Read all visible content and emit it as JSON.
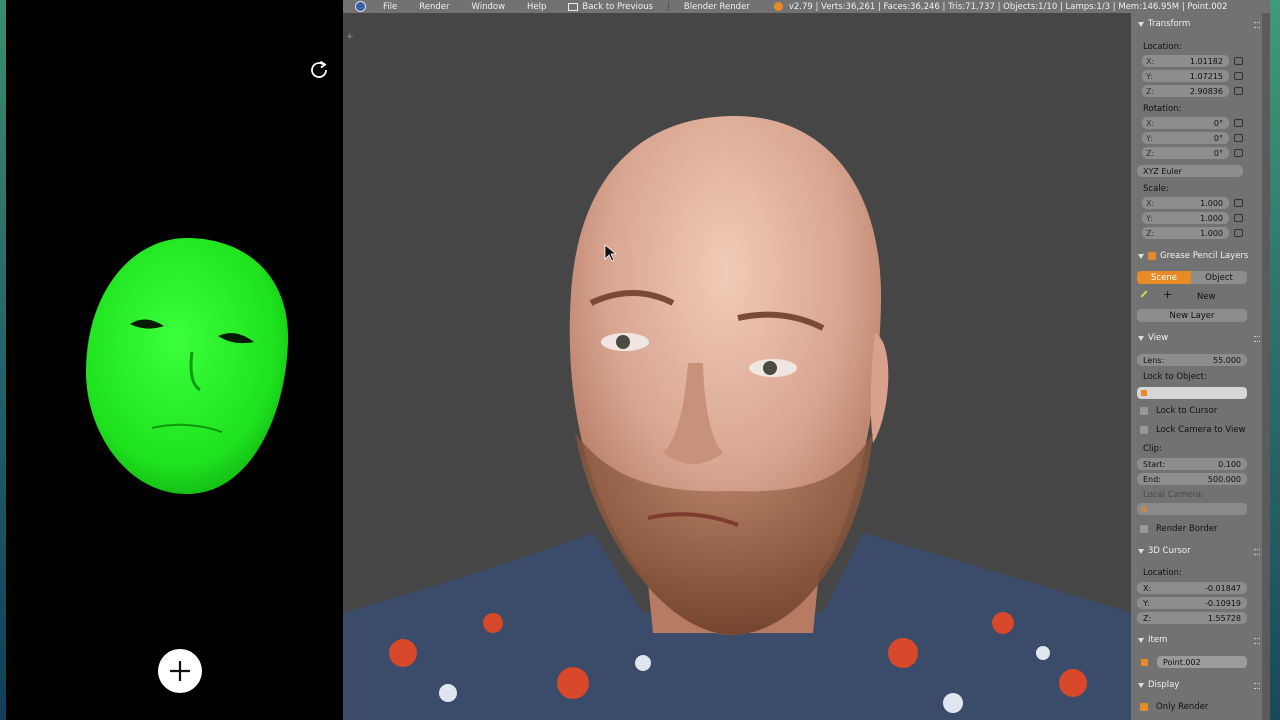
{
  "colors": {
    "accent": "#e88b26",
    "panel": "#727272",
    "viewport": "#464646",
    "mask": "#22e622"
  },
  "phone": {
    "refresh_icon": "refresh-icon",
    "add_icon": "plus-icon"
  },
  "menubar": {
    "items": [
      "File",
      "Render",
      "Window",
      "Help"
    ],
    "back_label": "Back to Previous",
    "engine": "Blender Render",
    "stats": "v2.79 | Verts:36,261 | Faces:36,246 | Tris:71,737 | Objects:1/10 | Lamps:1/3 | Mem:146.95M | Point.002"
  },
  "transform": {
    "header": "Transform",
    "location_label": "Location:",
    "location": [
      {
        "k": "X:",
        "v": "1.01182"
      },
      {
        "k": "Y:",
        "v": "1.07215"
      },
      {
        "k": "Z:",
        "v": "2.90836"
      }
    ],
    "rotation_label": "Rotation:",
    "rotation": [
      {
        "k": "X:",
        "v": "0°"
      },
      {
        "k": "Y:",
        "v": "0°"
      },
      {
        "k": "Z:",
        "v": "0°"
      }
    ],
    "rotation_mode": "XYZ Euler",
    "scale_label": "Scale:",
    "scale": [
      {
        "k": "X:",
        "v": "1.000"
      },
      {
        "k": "Y:",
        "v": "1.000"
      },
      {
        "k": "Z:",
        "v": "1.000"
      }
    ]
  },
  "grease": {
    "header": "Grease Pencil Layers",
    "tab_scene": "Scene",
    "tab_object": "Object",
    "new": "New",
    "new_layer": "New Layer"
  },
  "view": {
    "header": "View",
    "lens_label": "Lens:",
    "lens": "55.000",
    "lock_object_label": "Lock to Object:",
    "lock_cursor": "Lock to Cursor",
    "lock_camera": "Lock Camera to View",
    "clip_label": "Clip:",
    "start_label": "Start:",
    "start": "0.100",
    "end_label": "End:",
    "end": "500.000",
    "local_camera": "Local Camera:",
    "render_border": "Render Border"
  },
  "cursor": {
    "header": "3D Cursor",
    "location_label": "Location:",
    "location": [
      {
        "k": "X:",
        "v": "-0.01847"
      },
      {
        "k": "Y:",
        "v": "-0.10919"
      },
      {
        "k": "Z:",
        "v": "1.55728"
      }
    ]
  },
  "item": {
    "header": "Item",
    "name": "Point.002"
  },
  "display": {
    "header": "Display",
    "only_render": "Only Render"
  }
}
